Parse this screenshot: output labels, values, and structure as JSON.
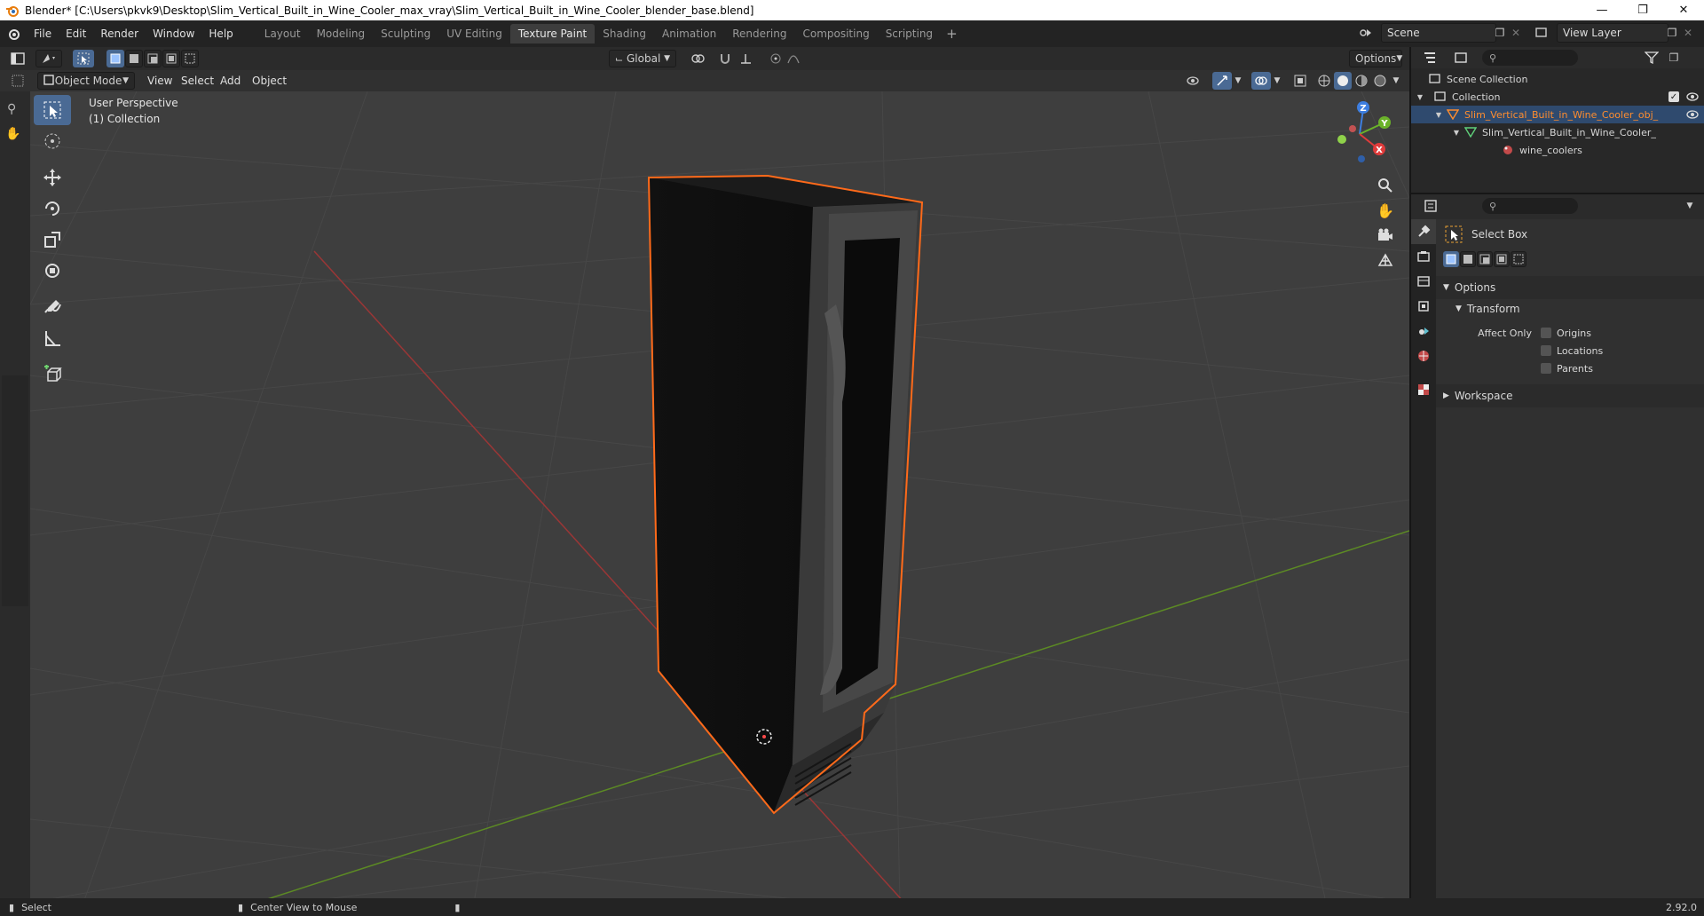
{
  "window": {
    "title": "Blender* [C:\\Users\\pkvk9\\Desktop\\Slim_Vertical_Built_in_Wine_Cooler_max_vray\\Slim_Vertical_Built_in_Wine_Cooler_blender_base.blend]"
  },
  "menu": [
    "File",
    "Edit",
    "Render",
    "Window",
    "Help"
  ],
  "workspaces": [
    "Layout",
    "Modeling",
    "Sculpting",
    "UV Editing",
    "Texture Paint",
    "Shading",
    "Animation",
    "Rendering",
    "Compositing",
    "Scripting"
  ],
  "active_workspace": "Texture Paint",
  "scene": {
    "name": "Scene",
    "view_layer": "View Layer"
  },
  "viewport_header": {
    "transform_orientation": "Global",
    "options_label": "Options",
    "mode": "Object Mode",
    "menus": [
      "View",
      "Select",
      "Add",
      "Object"
    ]
  },
  "viewport": {
    "perspective_label": "User Perspective",
    "collection_label": "(1) Collection",
    "gizmo_axes": [
      "Z",
      "Y",
      "X"
    ]
  },
  "outliner": {
    "items": [
      {
        "label": "Scene Collection",
        "level": 0
      },
      {
        "label": "Collection",
        "level": 1
      },
      {
        "label": "Slim_Vertical_Built_in_Wine_Cooler_obj_",
        "level": 2,
        "selected": true
      },
      {
        "label": "Slim_Vertical_Built_in_Wine_Cooler_",
        "level": 3
      },
      {
        "label": "wine_coolers",
        "level": 4
      }
    ]
  },
  "properties": {
    "tool_name": "Select Box",
    "options_label": "Options",
    "transform_label": "Transform",
    "affect_only_label": "Affect Only",
    "checkboxes": [
      "Origins",
      "Locations",
      "Parents"
    ],
    "workspace_label": "Workspace"
  },
  "statusbar": {
    "left": "Select",
    "middle": "Center View to Mouse",
    "version": "2.92.0"
  },
  "colors": {
    "selection_outline": "#ff6a1a",
    "x_axis": "#b33a3a",
    "y_axis": "#6a9a2a",
    "active_blue": "#4a6a94"
  }
}
